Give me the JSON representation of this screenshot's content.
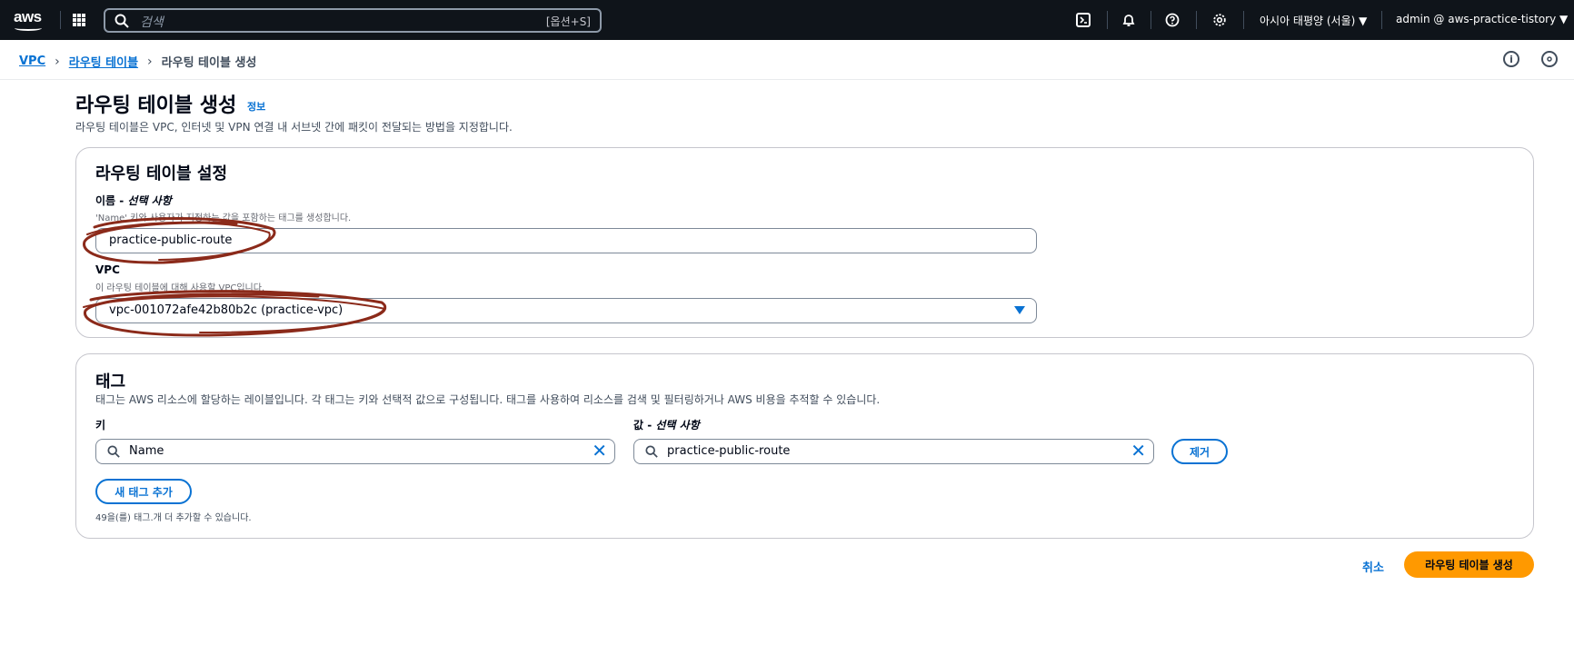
{
  "topnav": {
    "logo_text": "aws",
    "search_placeholder": "검색",
    "search_shortcut": "[옵션+S]",
    "region": "아시아 태평양 (서울) ▼",
    "account": "admin @ aws-practice-tistory ▼"
  },
  "breadcrumb": {
    "items": [
      "VPC",
      "라우팅 테이블"
    ],
    "current": "라우팅 테이블 생성"
  },
  "header": {
    "title": "라우팅 테이블 생성",
    "info": "정보",
    "description": "라우팅 테이블은 VPC, 인터넷 및 VPN 연결 내 서브넷 간에 패킷이 전달되는 방법을 지정합니다."
  },
  "settings": {
    "title": "라우팅 테이블 설정",
    "name_label": "이름 - ",
    "name_optional": "선택 사항",
    "name_hint": "'Name' 키와 사용자가 지정하는 값을 포함하는 태그를 생성합니다.",
    "name_value": "practice-public-route",
    "vpc_label": "VPC",
    "vpc_hint": "이 라우팅 테이블에 대해 사용할 VPC입니다.",
    "vpc_value": "vpc-001072afe42b80b2c (practice-vpc)"
  },
  "tags": {
    "title": "태그",
    "description": "태그는 AWS 리소스에 할당하는 레이블입니다. 각 태그는 키와 선택적 값으로 구성됩니다. 태그를 사용하여 리소스를 검색 및 필터링하거나 AWS 비용을 추적할 수 있습니다.",
    "key_label": "키",
    "value_label": "값 - ",
    "value_optional": "선택 사항",
    "key_value": "Name",
    "value_value": "practice-public-route",
    "remove_label": "제거",
    "add_label": "새 태그 추가",
    "remaining": "49을(를) 태그.개 더 추가할 수 있습니다."
  },
  "actions": {
    "cancel": "취소",
    "create": "라우팅 테이블 생성"
  },
  "colors": {
    "nav_bg": "#0f141a",
    "link": "#0972d3",
    "primary": "#ff9900",
    "annotation": "#8b2a1a"
  }
}
